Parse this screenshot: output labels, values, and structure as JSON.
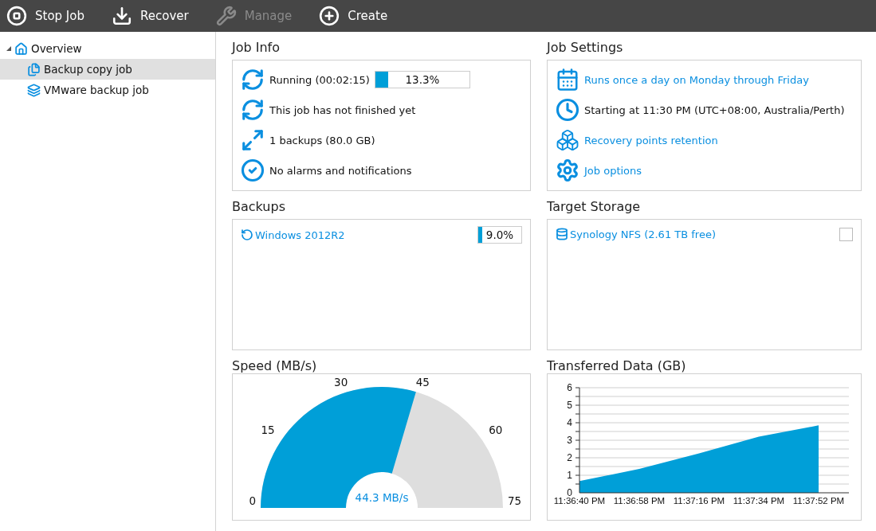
{
  "toolbar": [
    {
      "kind": "stop",
      "label": "Stop Job",
      "disabled": false
    },
    {
      "kind": "recover",
      "label": "Recover",
      "disabled": false
    },
    {
      "kind": "manage",
      "label": "Manage",
      "disabled": true
    },
    {
      "kind": "create",
      "label": "Create",
      "disabled": false
    }
  ],
  "sidebar": {
    "items": [
      {
        "kind": "home",
        "label": "Overview",
        "expanded": true,
        "selected": false,
        "children": [
          {
            "kind": "copy",
            "label": "Backup copy job",
            "selected": true
          },
          {
            "kind": "vmware",
            "label": "VMware backup job",
            "selected": false
          }
        ]
      }
    ]
  },
  "job_info": {
    "title": "Job Info",
    "items": [
      {
        "kind": "status",
        "text": "Running (00:02:15)",
        "progress": {
          "level": 0.133,
          "reading": "13.3%"
        }
      },
      {
        "kind": "result",
        "text": "This job has not finished yet"
      },
      {
        "kind": "backups",
        "text": "1 backups (80.0 GB)"
      },
      {
        "kind": "alarms",
        "text": "No alarms and notifications"
      }
    ]
  },
  "job_settings": {
    "title": "Job Settings",
    "items": [
      {
        "kind": "schedule",
        "text": "Runs once a day on Monday through Friday",
        "link": true
      },
      {
        "kind": "start",
        "text": "Starting at 11:30 PM (UTC+08:00, Australia/Perth)",
        "link": false
      },
      {
        "kind": "retention",
        "text": "Recovery points retention",
        "link": true
      },
      {
        "kind": "options",
        "text": "Job options",
        "link": true
      }
    ]
  },
  "backups": {
    "title": "Backups",
    "items": [
      {
        "name": "Windows 2012R2",
        "level": 0.09,
        "reading": "9.0%"
      }
    ]
  },
  "target_storage": {
    "title": "Target Storage",
    "items": [
      {
        "name": "Synology NFS (2.61 TB free)",
        "checked": false
      }
    ]
  },
  "speed": {
    "title": "Speed (MB/s)",
    "gauge": {
      "level": 0.591,
      "ticks": [
        "0",
        "15",
        "30",
        "45",
        "60",
        "75"
      ],
      "reading": "44.3 MB/s"
    }
  },
  "transferred": {
    "title": "Transferred Data (GB)",
    "chart_data": {
      "type": "area",
      "categories": [
        "11:36:40 PM",
        "11:36:58 PM",
        "11:37:16 PM",
        "11:37:34 PM",
        "11:37:52 PM"
      ],
      "series": [
        {
          "color": "#009fd8",
          "values": [
            0.67,
            1.36,
            2.25,
            3.2,
            3.85
          ]
        }
      ],
      "ylim": [
        0,
        6
      ],
      "grid": true,
      "yticks": [
        0,
        1,
        2,
        3,
        4,
        5,
        6
      ]
    }
  }
}
